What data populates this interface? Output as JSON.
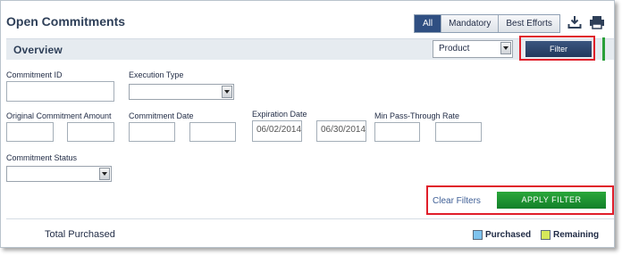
{
  "header": {
    "title": "Open Commitments"
  },
  "toggle": {
    "options": [
      "All",
      "Mandatory",
      "Best Efforts"
    ],
    "active": "All"
  },
  "icons": {
    "download": "download-icon",
    "print": "print-icon"
  },
  "overview": {
    "label": "Overview",
    "product_select": "Product",
    "filter_button": "Filter"
  },
  "form": {
    "commitment_id": {
      "label": "Commitment ID",
      "value": ""
    },
    "execution_type": {
      "label": "Execution Type",
      "value": ""
    },
    "original_amount": {
      "label": "Original Commitment Amount",
      "min": "",
      "max": ""
    },
    "commitment_date": {
      "label": "Commitment Date",
      "from": "",
      "to": ""
    },
    "expiration_date": {
      "label": "Expiration Date",
      "from": "06/02/2014",
      "to": "06/30/2014"
    },
    "min_pass_through": {
      "label": "Min Pass-Through Rate",
      "min": "",
      "max": ""
    },
    "commitment_status": {
      "label": "Commitment Status",
      "value": ""
    }
  },
  "actions": {
    "clear": "Clear Filters",
    "apply": "APPLY FILTER"
  },
  "summary": {
    "total_label": "Total Purchased",
    "legend": [
      {
        "label": "Purchased",
        "color": "#7ec3ee"
      },
      {
        "label": "Remaining",
        "color": "#d6e85a"
      }
    ]
  },
  "colors": {
    "accent": "#2f4f82",
    "green": "#1f9a36",
    "highlight": "#e01e2a"
  }
}
